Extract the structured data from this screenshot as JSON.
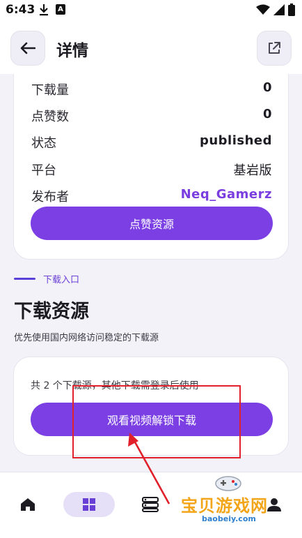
{
  "status_bar": {
    "time": "6:43",
    "badge": "A",
    "icons": [
      "download-icon",
      "wifi-icon",
      "signal-icon",
      "battery-icon"
    ]
  },
  "app_bar": {
    "title": "详情",
    "back_icon": "back-arrow-icon",
    "external_icon": "open-external-icon"
  },
  "details": {
    "rows": [
      {
        "key": "下载量",
        "value": "0"
      },
      {
        "key": "点赞数",
        "value": "0"
      },
      {
        "key": "状态",
        "value": "published"
      },
      {
        "key": "平台",
        "value": "基岩版"
      },
      {
        "key": "发布者",
        "value": "Neq_Gamerz"
      }
    ],
    "like_button": "点赞资源"
  },
  "download_section": {
    "label": "下载入口",
    "title": "下载资源",
    "subtitle": "优先使用国内网络访问稳定的下载源",
    "count_text": "共 2 个下载源，其他下载需登录后使用",
    "unlock_button": "观看视频解锁下载"
  },
  "bottom_nav": {
    "items": [
      "home-icon",
      "grid-icon",
      "list-icon",
      "person-icon"
    ],
    "active": "grid-icon"
  },
  "watermark": {
    "text": "宝贝游戏网",
    "url": "baobeiy.com"
  },
  "colors": {
    "accent": "#7b3fe4",
    "annotation": "#e0202a",
    "background": "#f3f2f9"
  }
}
